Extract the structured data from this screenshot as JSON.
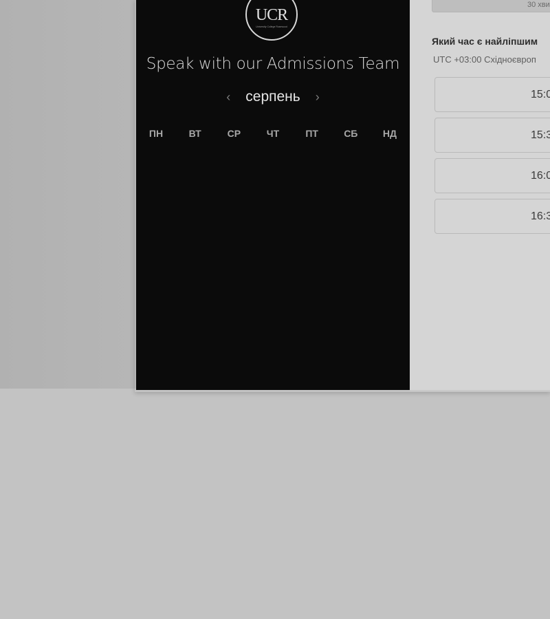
{
  "logo": {
    "text": "UCR",
    "tagline": "University College Rosewood"
  },
  "calendar": {
    "title": "Speak with our Admissions Team",
    "month": "серпень",
    "prev_icon": "chevron-left-icon",
    "next_icon": "chevron-right-icon",
    "weekdays": [
      "ПН",
      "ВТ",
      "СР",
      "ЧТ",
      "ПТ",
      "СБ",
      "НД"
    ]
  },
  "booking": {
    "duration": "30 хви",
    "heading": "Який час є найліпшим",
    "timezone": "UTC +03:00 Східноєвроп",
    "slots": [
      "15:0",
      "15:3",
      "16:0",
      "16:3"
    ]
  },
  "colors": {
    "panel_bg": "#0b0b0b",
    "right_bg": "#d5d5d5",
    "page_bg": "#c3c3c3"
  }
}
